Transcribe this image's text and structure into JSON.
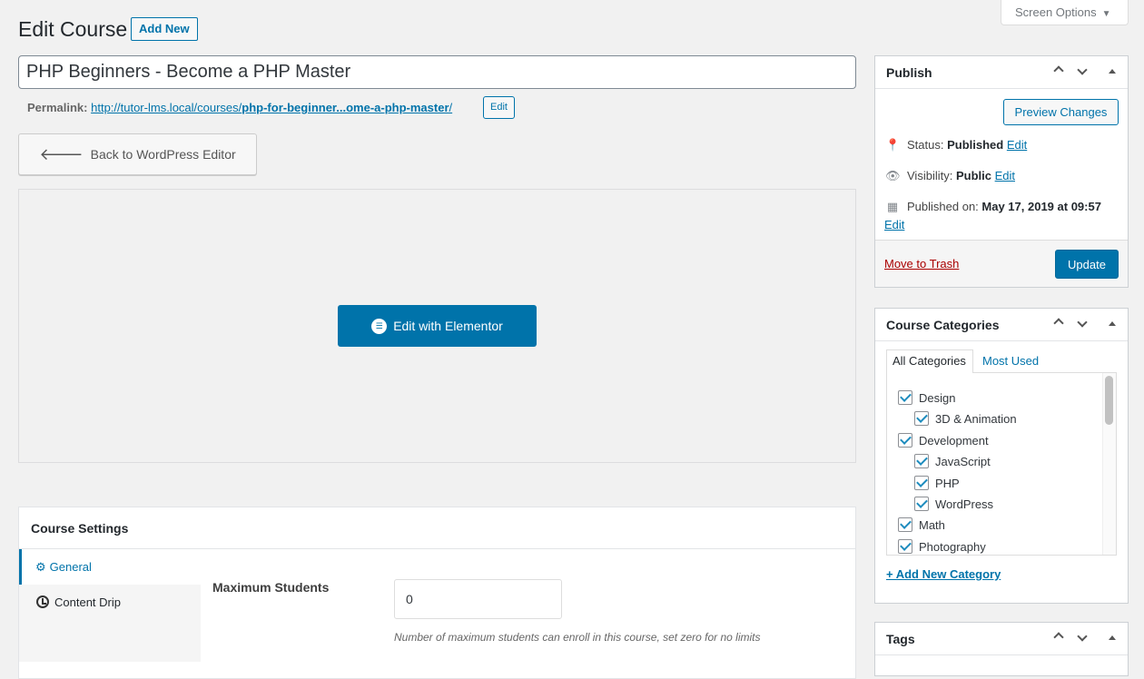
{
  "header": {
    "title": "Edit Course",
    "add_new": "Add New",
    "screen_options": "Screen Options"
  },
  "post": {
    "title": "PHP Beginners - Become a PHP Master",
    "permalink_label": "Permalink:",
    "permalink_base": "http://tutor-lms.local/courses/",
    "permalink_slug": "php-for-beginner...ome-a-php-master",
    "permalink_trail": "/",
    "permalink_edit": "Edit"
  },
  "editor": {
    "back_label": "Back to WordPress Editor",
    "elementor_label": "Edit with Elementor"
  },
  "course_settings": {
    "title": "Course Settings",
    "tabs": [
      {
        "label": "General",
        "active": true
      },
      {
        "label": "Content Drip",
        "active": false
      }
    ],
    "max_students_label": "Maximum Students",
    "max_students_value": "0",
    "max_students_help": "Number of maximum students can enroll in this course, set zero for no limits"
  },
  "publish": {
    "title": "Publish",
    "preview": "Preview Changes",
    "status_label": "Status:",
    "status_value": "Published",
    "visibility_label": "Visibility:",
    "visibility_value": "Public",
    "published_label": "Published on:",
    "published_value": "May 17, 2019 at 09:57",
    "edit": "Edit",
    "trash": "Move to Trash",
    "update": "Update"
  },
  "categories": {
    "title": "Course Categories",
    "tab_all": "All Categories",
    "tab_used": "Most Used",
    "items": [
      {
        "label": "Design",
        "level": 0,
        "checked": true
      },
      {
        "label": "3D & Animation",
        "level": 1,
        "checked": true
      },
      {
        "label": "Development",
        "level": 0,
        "checked": true
      },
      {
        "label": "JavaScript",
        "level": 1,
        "checked": true
      },
      {
        "label": "PHP",
        "level": 1,
        "checked": true
      },
      {
        "label": "WordPress",
        "level": 1,
        "checked": true
      },
      {
        "label": "Math",
        "level": 0,
        "checked": true
      },
      {
        "label": "Photography",
        "level": 0,
        "checked": true
      }
    ],
    "add_new": "+ Add New Category"
  },
  "tags": {
    "title": "Tags"
  },
  "colors": {
    "accent": "#0073aa",
    "trash": "#aa0000",
    "background": "#f1f1f1"
  }
}
